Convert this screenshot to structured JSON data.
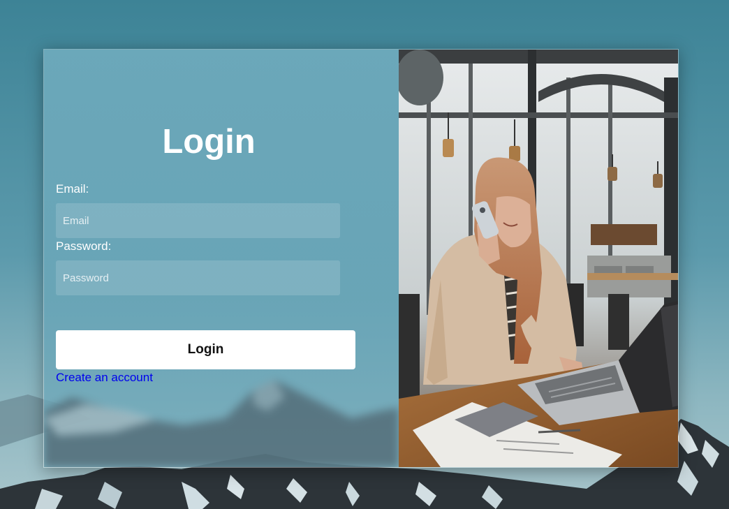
{
  "form": {
    "title": "Login",
    "email_label": "Email:",
    "email_placeholder": "Email",
    "email_value": "",
    "password_label": "Password:",
    "password_placeholder": "Password",
    "password_value": "",
    "submit_label": "Login",
    "create_account_label": "Create an account"
  },
  "colors": {
    "background": "#4f90a3",
    "panel": "#6eaabc",
    "button": "#ffffff",
    "link": "#0000ee"
  },
  "icons": {
    "photo": "woman-on-phone-with-laptop-photo",
    "background": "snowy-mountain-background"
  }
}
